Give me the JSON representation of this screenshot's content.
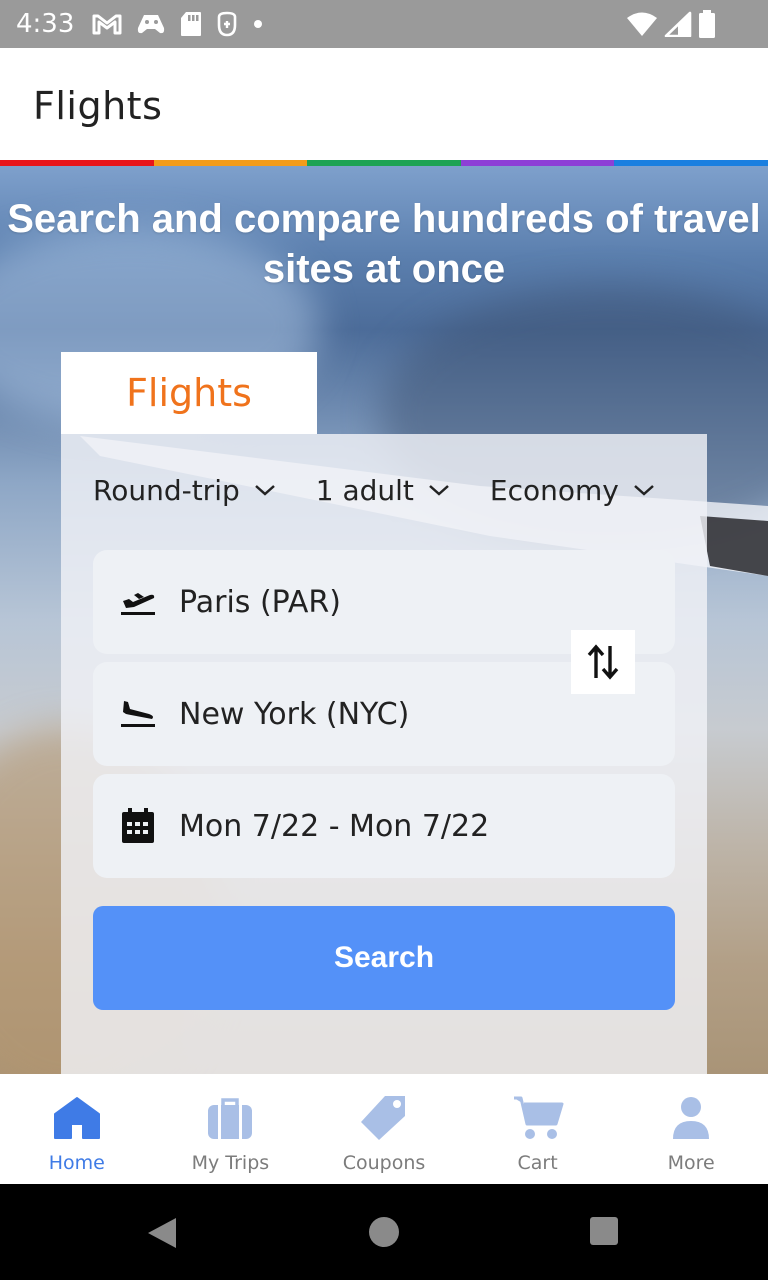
{
  "status_bar": {
    "time": "4:33",
    "icons_left": [
      "gmail-icon",
      "game-controller-icon",
      "sd-card-icon",
      "vpn-key-icon",
      "dot-icon"
    ],
    "icons_right": [
      "wifi-icon",
      "signal-icon",
      "battery-icon"
    ]
  },
  "app_bar": {
    "title": "Flights"
  },
  "accent_strip": [
    "#e8151b",
    "#f39c1b",
    "#1ea354",
    "#8d3fd6",
    "#1a7fe0"
  ],
  "hero": {
    "headline": "Search and compare hundreds of travel sites at once"
  },
  "search_card": {
    "tab_label": "Flights",
    "tab_color": "#f0731c",
    "trip_type": "Round-trip",
    "travelers": "1 adult",
    "cabin_class": "Economy",
    "origin": {
      "icon": "takeoff-icon",
      "value": "Paris (PAR)"
    },
    "destination": {
      "icon": "landing-icon",
      "value": "New York (NYC)"
    },
    "dates": {
      "icon": "calendar-icon",
      "value": "Mon 7/22 - Mon 7/22"
    },
    "swap_icon": "swap-vertical-icon",
    "search_label": "Search",
    "search_color": "#5491f8"
  },
  "bottom_nav": {
    "active_color": "#3f7be6",
    "inactive_color": "#a9bfe6",
    "items": [
      {
        "label": "Home",
        "icon": "home-icon",
        "active": true
      },
      {
        "label": "My Trips",
        "icon": "suitcase-icon",
        "active": false
      },
      {
        "label": "Coupons",
        "icon": "tag-icon",
        "active": false
      },
      {
        "label": "Cart",
        "icon": "cart-icon",
        "active": false
      },
      {
        "label": "More",
        "icon": "person-icon",
        "active": false
      }
    ]
  },
  "system_nav": [
    "back-icon",
    "home-circle-icon",
    "recents-icon"
  ]
}
